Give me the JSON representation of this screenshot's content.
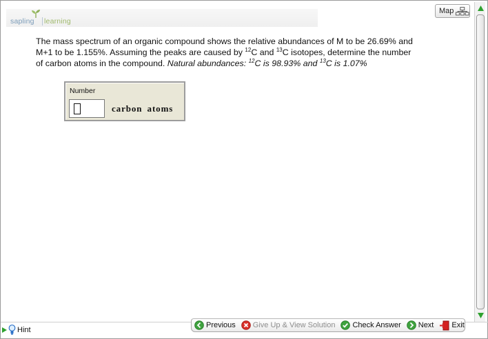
{
  "app": {
    "logo_word1": "sapling",
    "logo_word2": "learning"
  },
  "header": {
    "map_label": "Map"
  },
  "question": {
    "line1": "The mass spectrum of an organic compound shows the relative abundances of M to be 26.69% and",
    "line2a": "M+1 to be 1.155%. Assuming the peaks are caused by ",
    "iso12": "12",
    "line2b": "C and ",
    "iso13": "13",
    "line2c": "C isotopes, determine the number",
    "line3a": "of carbon atoms in the compound. ",
    "line3b": "Natural abundances: ",
    "line3c": "C is 98.93% and ",
    "line3d": "C is 1.07%"
  },
  "answer": {
    "label": "Number",
    "value": "",
    "unit": "carbon atoms"
  },
  "footer": {
    "hint_label": "Hint",
    "previous_label": "Previous",
    "giveup_label": "Give Up & View Solution",
    "check_label": "Check Answer",
    "next_label": "Next",
    "exit_label": "Exit"
  },
  "colors": {
    "answer_box_bg": "#e9e7d7",
    "nav_green": "#3fa33f",
    "giveup_red": "#d9302a",
    "exit_red": "#d42020",
    "hint_blue": "#2f73c9",
    "scroll_arrow_green": "#2fa12f"
  },
  "icons": {
    "map": "sitemap-icon",
    "previous": "arrow-left-circle-icon",
    "giveup": "x-circle-icon",
    "check": "checkmark-circle-icon",
    "next": "arrow-right-circle-icon",
    "exit": "exit-door-icon",
    "hint": "lightbulb-icon",
    "scroll_up": "triangle-up-icon",
    "scroll_down": "triangle-down-icon"
  }
}
